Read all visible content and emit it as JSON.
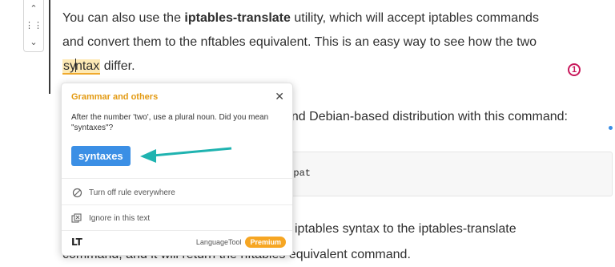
{
  "toolbar": {
    "up": "⌃",
    "drag": "⋮⋮",
    "down": "⌄"
  },
  "para1": {
    "line1_pre": "You can also use the ",
    "line1_bold": "iptables-translate",
    "line1_post": " utility, which will accept iptables commands",
    "line2": "and convert them to the nftables equivalent. This is an easy way to see how the two",
    "flag_word_a": "sy",
    "flag_word_b": "ntax",
    "line3_post": " differ."
  },
  "lt_badge": "1",
  "para2": "and Debian-based distribution with this command:",
  "code": "ompat",
  "para3": "iptables syntax to the iptables-translate",
  "para4": "command, and it will return the nftables equivalent command.",
  "popup": {
    "title": "Grammar and others",
    "close": "✕",
    "message": "After the number 'two', use a plural noun. Did you mean \"syntaxes\"?",
    "suggestion": "syntaxes",
    "turn_off": "Turn off rule everywhere",
    "ignore": "Ignore in this text",
    "logo": "LT",
    "brand": "LanguageTool",
    "premium": "Premium"
  },
  "colors": {
    "accent": "#3b8fe5",
    "warning": "#e39a12",
    "badge": "#c8175a",
    "arrow": "#1fb3b0"
  }
}
